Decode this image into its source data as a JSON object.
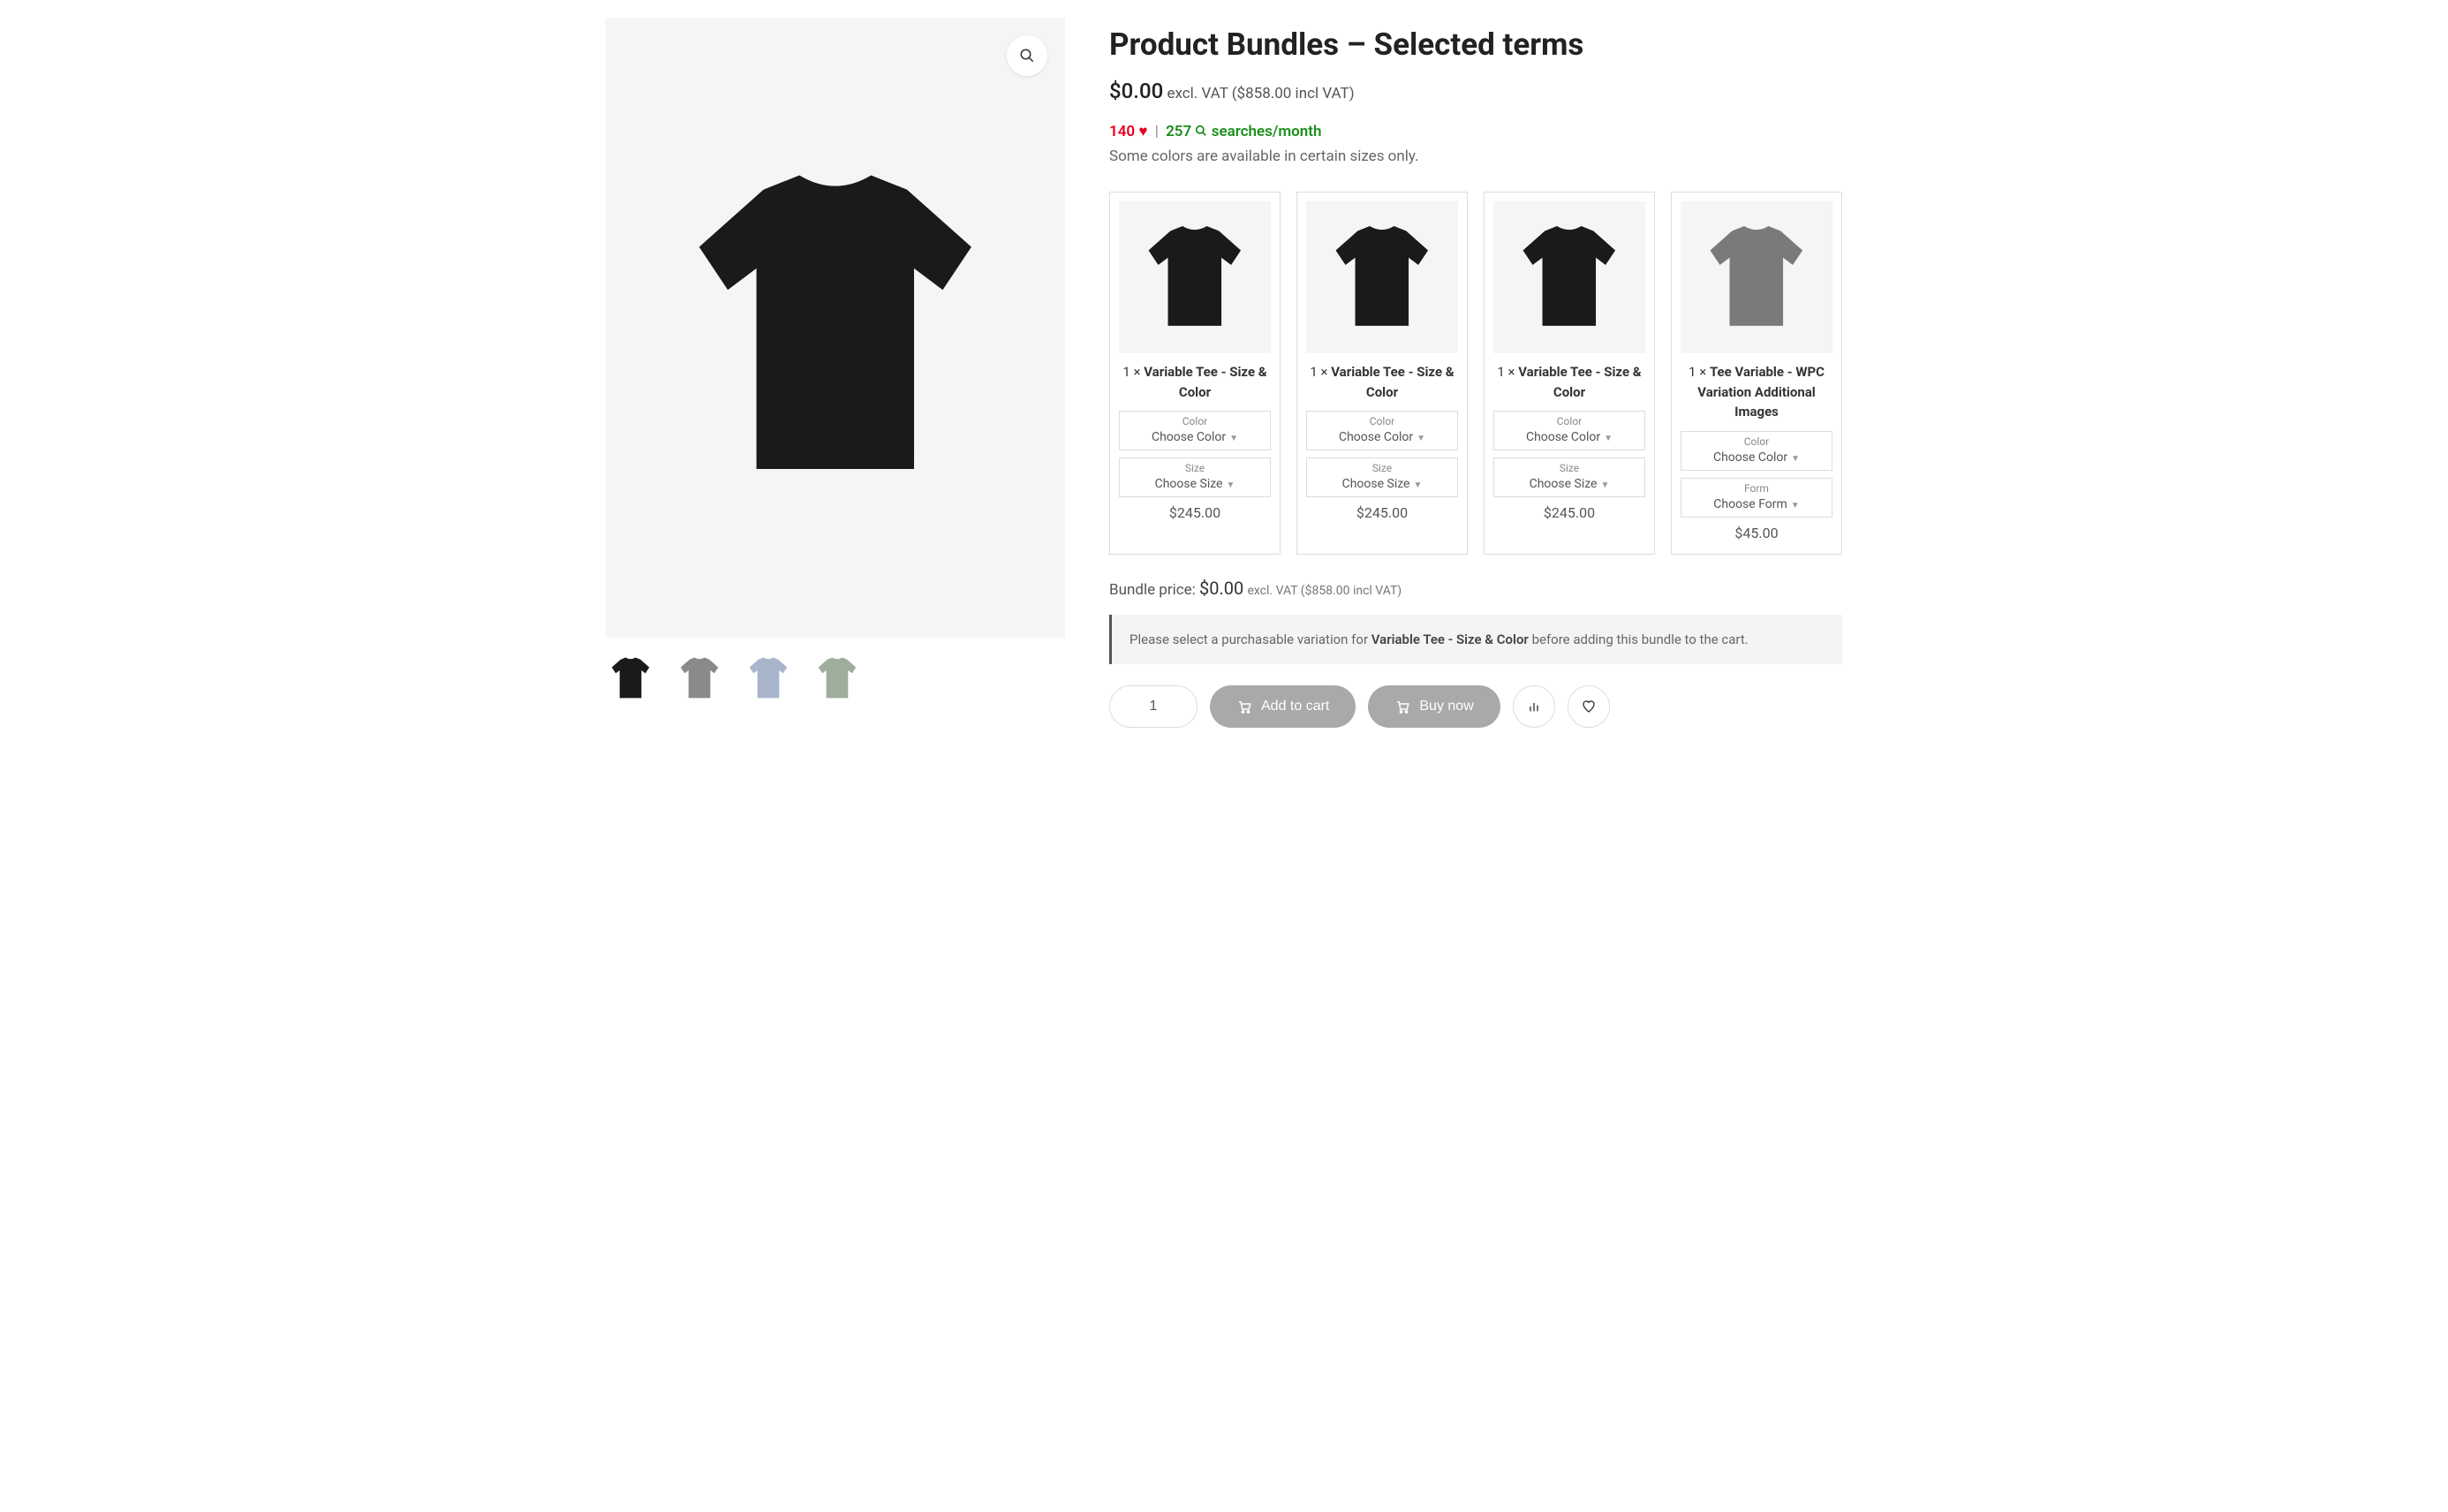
{
  "product": {
    "title": "Product Bundles – Selected terms",
    "price": "$0.00",
    "price_suffix": "excl. VAT ($858.00 incl VAT)",
    "likes": "140",
    "searches": "257",
    "searches_label": "searches/month",
    "description": "Some colors are available in certain sizes only."
  },
  "thumbs": [
    {
      "color": "#1a1a1a"
    },
    {
      "color": "#8a8a8a"
    },
    {
      "color": "#a9b5cc"
    },
    {
      "color": "#9fae9a"
    }
  ],
  "bundle_items": [
    {
      "qty": "1 ×",
      "name": "Variable Tee - Size & Color",
      "shirt_color": "#1a1a1a",
      "variations": [
        {
          "label": "Color",
          "value": "Choose Color"
        },
        {
          "label": "Size",
          "value": "Choose Size"
        }
      ],
      "price": "$245.00"
    },
    {
      "qty": "1 ×",
      "name": "Variable Tee - Size & Color",
      "shirt_color": "#1a1a1a",
      "variations": [
        {
          "label": "Color",
          "value": "Choose Color"
        },
        {
          "label": "Size",
          "value": "Choose Size"
        }
      ],
      "price": "$245.00"
    },
    {
      "qty": "1 ×",
      "name": "Variable Tee - Size & Color",
      "shirt_color": "#1a1a1a",
      "variations": [
        {
          "label": "Color",
          "value": "Choose Color"
        },
        {
          "label": "Size",
          "value": "Choose Size"
        }
      ],
      "price": "$245.00"
    },
    {
      "qty": "1 ×",
      "name": "Tee Variable - WPC Variation Additional Images",
      "shirt_color": "#7a7a7a",
      "variations": [
        {
          "label": "Color",
          "value": "Choose Color"
        },
        {
          "label": "Form",
          "value": "Choose Form"
        }
      ],
      "price": "$45.00"
    }
  ],
  "bundle_total": {
    "label": "Bundle price:",
    "amount": "$0.00",
    "suffix": "excl. VAT ($858.00 incl VAT)"
  },
  "notice": {
    "prefix": "Please select a purchasable variation for ",
    "strong": "Variable Tee - Size & Color",
    "suffix": " before adding this bundle to the cart."
  },
  "actions": {
    "qty": "1",
    "add_to_cart": "Add to cart",
    "buy_now": "Buy now"
  }
}
